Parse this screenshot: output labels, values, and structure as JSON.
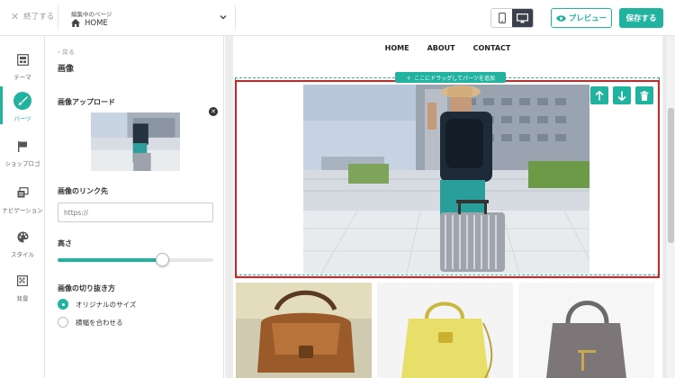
{
  "topbar": {
    "exit_label": "終了する",
    "page_caption": "編集中のページ",
    "page_name": "HOME",
    "preview_label": "プレビュー",
    "save_label": "保存する"
  },
  "rail": {
    "items": [
      {
        "label": "テーマ",
        "icon": "theme-icon"
      },
      {
        "label": "パーツ",
        "icon": "brush-icon"
      },
      {
        "label": "ショップロゴ",
        "icon": "flag-icon"
      },
      {
        "label": "ナビゲーション",
        "icon": "navigation-icon"
      },
      {
        "label": "スタイル",
        "icon": "palette-icon"
      },
      {
        "label": "背景",
        "icon": "background-icon"
      }
    ]
  },
  "panel": {
    "back_label": "戻る",
    "title": "画像",
    "upload_label": "画像アップロード",
    "link_label": "画像のリンク先",
    "link_placeholder": "https://",
    "height_label": "高さ",
    "height_value": 0.67,
    "crop_label": "画像の切り抜き方",
    "crop_options": [
      "オリジナルのサイズ",
      "横幅を合わせる"
    ],
    "crop_selected": 0
  },
  "site": {
    "nav": [
      "HOME",
      "ABOUT",
      "CONTACT"
    ],
    "drop_tag": "ここにドラッグしてパーツを追加"
  },
  "colors": {
    "accent": "#22b3a0",
    "selection": "#e11c1c",
    "dark_toggle": "#3c3f4d"
  }
}
